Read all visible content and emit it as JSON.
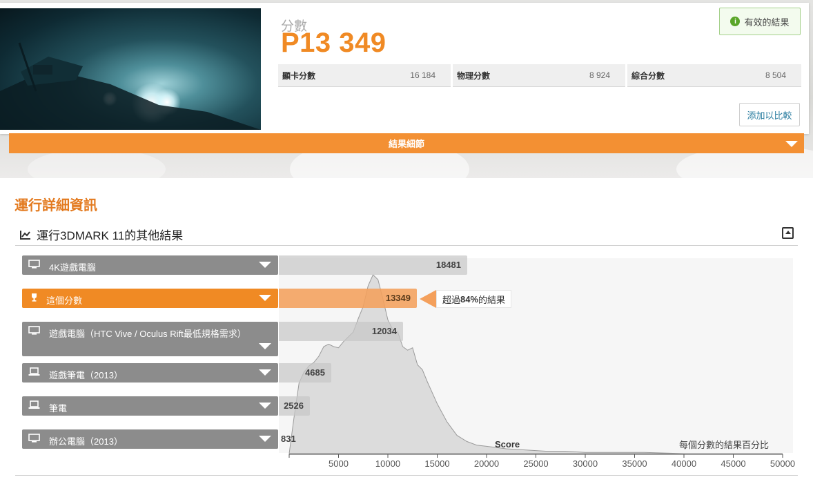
{
  "result": {
    "score_label": "分數",
    "score_value": "P13 349",
    "valid_label": "有效的結果",
    "valid_icon": "info-icon",
    "subscores": [
      {
        "label": "顯卡分數",
        "value": "16 184"
      },
      {
        "label": "物理分數",
        "value": "8 924"
      },
      {
        "label": "綜合分數",
        "value": "8 504"
      }
    ],
    "compare_label": "添加以比較",
    "details_label": "結果細節"
  },
  "run_details": {
    "title": "運行詳細資訊",
    "other_results_title": "運行3DMARK 11的其他結果"
  },
  "comparison": {
    "rows": [
      {
        "label": "4K遊戲電腦",
        "value": "18481",
        "icon": "desktop-icon",
        "mine": false
      },
      {
        "label": "這個分數",
        "value": "13349",
        "icon": "trophy-icon",
        "mine": true
      },
      {
        "label": "遊戲電腦（HTC Vive / Oculus Rift最低規格需求）",
        "value": "12034",
        "icon": "desktop-icon",
        "mine": false
      },
      {
        "label": "遊戲筆電（2013）",
        "value": "4685",
        "icon": "laptop-icon",
        "mine": false
      },
      {
        "label": "筆電",
        "value": "2526",
        "icon": "laptop-icon",
        "mine": false
      },
      {
        "label": "辦公電腦（2013）",
        "value": "831",
        "icon": "desktop-icon",
        "mine": false
      }
    ],
    "callout_prefix": "超過",
    "callout_percent": "84%",
    "callout_suffix": "的結果",
    "colors": {
      "accent": "#f08a24",
      "row_gray": "#8c8c8c",
      "valid_green": "#5aa629",
      "link": "#2a7da0"
    }
  },
  "chart_data": {
    "type": "area",
    "xlabel": "Score",
    "ylabel": "每個分數的結果百分比",
    "xlim": [
      0,
      50000
    ],
    "x_ticks": [
      5000,
      10000,
      15000,
      20000,
      25000,
      30000,
      35000,
      40000,
      45000,
      50000
    ],
    "x": [
      0,
      500,
      1000,
      1500,
      2000,
      2500,
      3000,
      3500,
      4000,
      4500,
      5000,
      5500,
      6000,
      6500,
      7000,
      7500,
      8000,
      8500,
      9000,
      9500,
      10000,
      10500,
      11000,
      11500,
      12000,
      12500,
      13000,
      13500,
      14000,
      14500,
      15000,
      16000,
      17000,
      18000,
      19000,
      20000,
      22000,
      24000,
      26000,
      28000,
      30000,
      33000,
      36000,
      40000,
      45000,
      50000
    ],
    "values": [
      0,
      30,
      58,
      67,
      72,
      75,
      80,
      88,
      90,
      88,
      87,
      92,
      96,
      100,
      111,
      121,
      138,
      147,
      143,
      127,
      110,
      102,
      100,
      88,
      85,
      87,
      73,
      69,
      59,
      50,
      41,
      26,
      15,
      10,
      7,
      6,
      4,
      3,
      2,
      2,
      1,
      1,
      1,
      0,
      0,
      0
    ],
    "grid": false
  }
}
